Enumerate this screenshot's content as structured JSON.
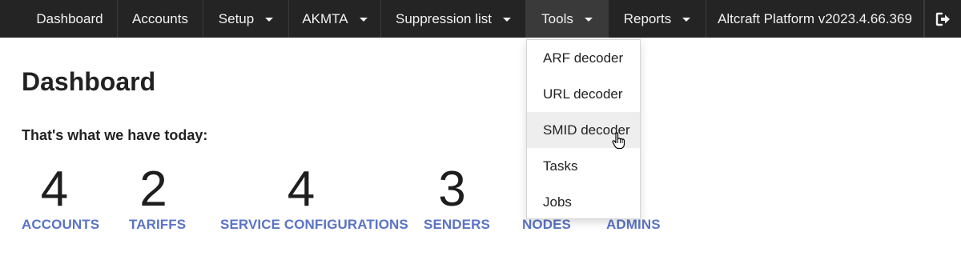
{
  "nav": {
    "items": [
      {
        "label": "Dashboard",
        "dropdown": false
      },
      {
        "label": "Accounts",
        "dropdown": false
      },
      {
        "label": "Setup",
        "dropdown": true
      },
      {
        "label": "AKMTA",
        "dropdown": true
      },
      {
        "label": "Suppression list",
        "dropdown": true
      },
      {
        "label": "Tools",
        "dropdown": true,
        "active": true
      },
      {
        "label": "Reports",
        "dropdown": true
      }
    ],
    "version": "Altcraft Platform v2023.4.66.369",
    "logout_icon": "sign-out-icon"
  },
  "tools_menu": {
    "items": [
      "ARF decoder",
      "URL decoder",
      "SMID decoder",
      "Tasks",
      "Jobs"
    ],
    "hovered": "SMID decoder"
  },
  "page": {
    "title": "Dashboard",
    "subtitle": "That's what we have today:"
  },
  "stats": [
    {
      "value": "4",
      "label": "ACCOUNTS"
    },
    {
      "value": "2",
      "label": "TARIFFS"
    },
    {
      "value": "4",
      "label": "SERVICE CONFIGURATIONS"
    },
    {
      "value": "3",
      "label": "SENDERS"
    },
    {
      "value": "",
      "label": "NODES"
    },
    {
      "value": "",
      "label": "ADMINS"
    }
  ],
  "colors": {
    "navbar": "#242424",
    "stat_label": "#5b74c4",
    "menu_hover": "#eeeeee"
  }
}
